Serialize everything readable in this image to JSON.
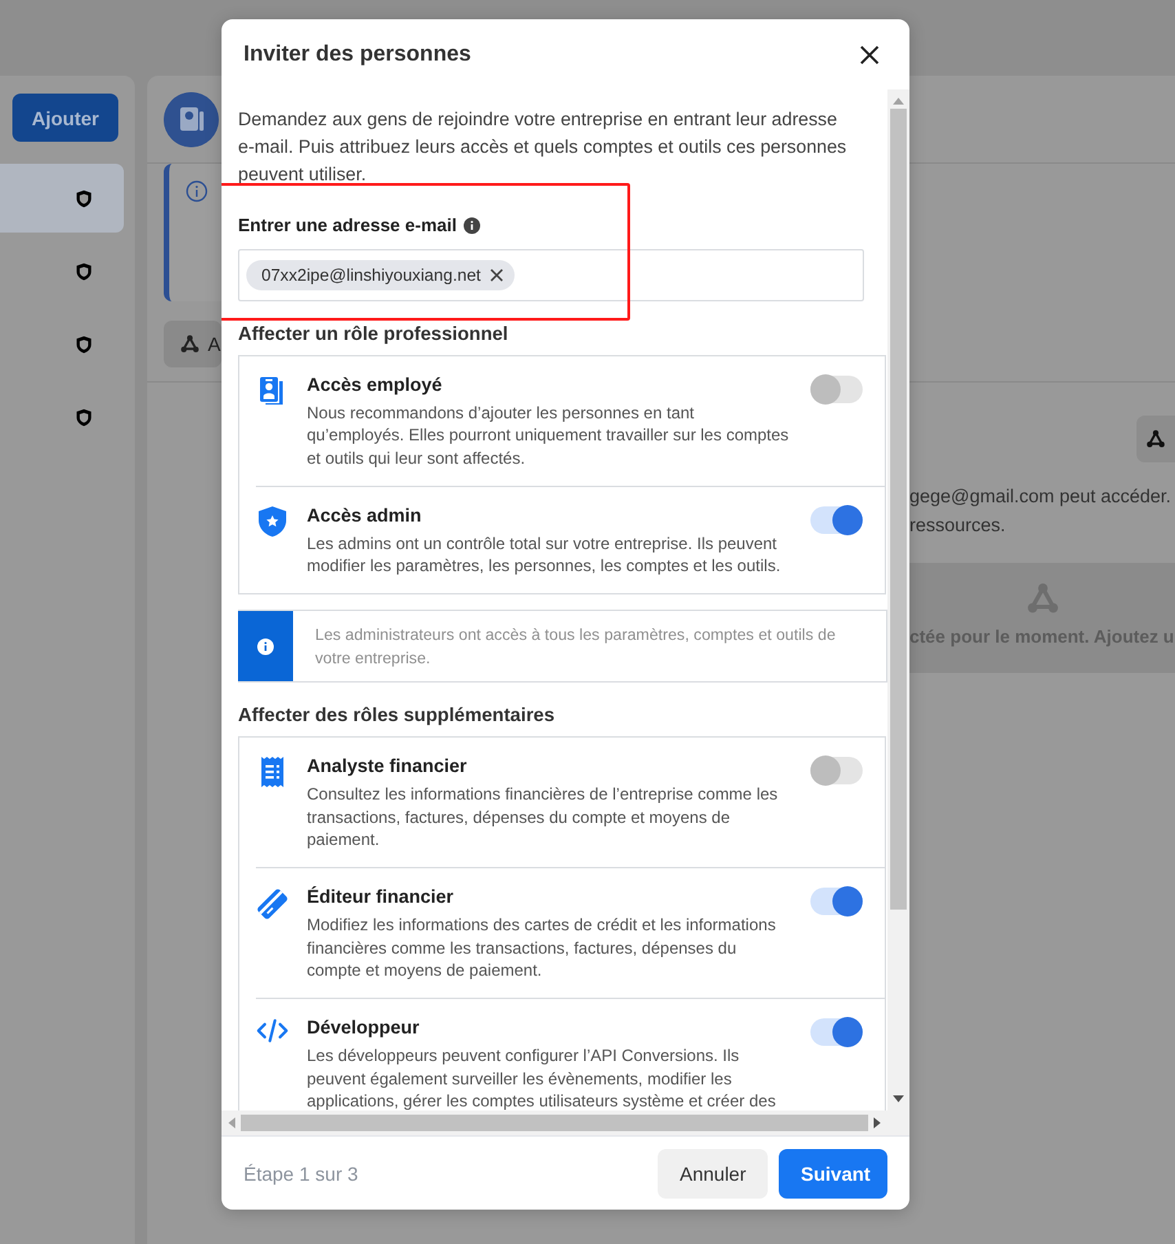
{
  "background": {
    "add_button": "Ajouter",
    "sidebar_items": [
      {
        "selected": true
      },
      {
        "selected": false
      },
      {
        "selected": false
      },
      {
        "selected": false
      }
    ],
    "partial_button": "A",
    "access_lines": [
      "gege@gmail.com peut accéder.",
      "ressources."
    ],
    "empty_state": "ctée pour le moment. Ajoutez u"
  },
  "dialog": {
    "title": "Inviter des personnes",
    "intro": "Demandez aux gens de rejoindre votre entreprise en entrant leur adresse e-mail. Puis attribuez leurs accès et quels comptes et outils ces personnes peuvent utiliser.",
    "email_label": "Entrer une adresse e-mail",
    "email_chips": [
      "07xx2ipe@linshiyouxiang.net"
    ],
    "role_section_title": "Affecter un rôle professionnel",
    "roles": [
      {
        "kind": "badge",
        "title": "Accès employé",
        "description": "Nous recommandons d’ajouter les personnes en tant qu’employés. Elles pourront uniquement travailler sur les comptes et outils qui leur sont affectés.",
        "on": false
      },
      {
        "kind": "shield",
        "title": "Accès admin",
        "description": "Les admins ont un contrôle total sur votre entreprise. Ils peuvent modifier les paramètres, les personnes, les comptes et les outils.",
        "on": true
      }
    ],
    "admin_notice": "Les administrateurs ont accès à tous les paramètres, comptes et outils de votre entreprise.",
    "extra_section_title": "Affecter des rôles supplémentaires",
    "extra_roles": [
      {
        "kind": "receipt",
        "title": "Analyste financier",
        "description": "Consultez les informations financières de l’entreprise comme les transactions, factures, dépenses du compte et moyens de paiement.",
        "on": false
      },
      {
        "kind": "card",
        "title": "Éditeur financier",
        "description": "Modifiez les informations des cartes de crédit et les informations financières comme les transactions, factures, dépenses du compte et moyens de paiement.",
        "on": true
      },
      {
        "kind": "code",
        "title": "Développeur",
        "description": "Les développeurs peuvent configurer l’API Conversions. Ils peuvent également surveiller les évènements, modifier les applications, gérer les comptes utilisateurs système et créer des",
        "on": true
      }
    ],
    "step": "Étape 1 sur 3",
    "cancel_button": "Annuler",
    "next_button": "Suivant"
  }
}
